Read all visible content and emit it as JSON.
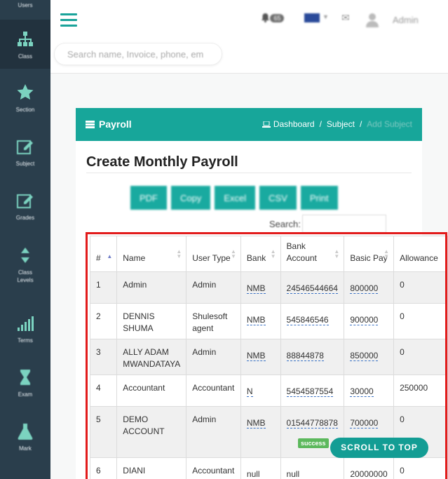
{
  "sidebar": {
    "items": [
      {
        "label": "Users",
        "icon": "users-icon"
      },
      {
        "label": "Class",
        "icon": "sitemap-icon"
      },
      {
        "label": "Section",
        "icon": "star-icon"
      },
      {
        "label": "Subject",
        "icon": "edit-icon"
      },
      {
        "label": "Grades",
        "icon": "edit-icon"
      },
      {
        "label": "Class Levels",
        "icon": "sort-icon"
      },
      {
        "label": "Terms",
        "icon": "signal-icon"
      },
      {
        "label": "Exam",
        "icon": "hourglass-icon"
      },
      {
        "label": "Mark",
        "icon": "flask-icon"
      }
    ]
  },
  "header": {
    "notification_count": "65",
    "user_name": "Admin",
    "search_placeholder": "Search name, Invoice, phone, em"
  },
  "panel": {
    "title": "Payroll",
    "breadcrumb": {
      "dashboard": "Dashboard",
      "subject": "Subject",
      "current": "Add Subject"
    },
    "page_title": "Create Monthly Payroll",
    "export_buttons": [
      "PDF",
      "Copy",
      "Excel",
      "CSV",
      "Print"
    ],
    "search_label": "Search:"
  },
  "table": {
    "columns": [
      "#",
      "Name",
      "User Type",
      "Bank",
      "Bank Account",
      "Basic Pay",
      "Allowance"
    ],
    "rows": [
      {
        "num": "1",
        "name": "Admin",
        "user_type": "Admin",
        "bank": "NMB",
        "account": "24546544664",
        "basic_pay": "800000",
        "allowance": "0"
      },
      {
        "num": "2",
        "name": "DENNIS SHUMA",
        "user_type": "Shulesoft agent",
        "bank": "NMB",
        "account": "545846546",
        "basic_pay": "900000",
        "allowance": "0"
      },
      {
        "num": "3",
        "name": "ALLY ADAM MWANDATAYA",
        "user_type": "Admin",
        "bank": "NMB",
        "account": "88844878",
        "basic_pay": "850000",
        "allowance": "0"
      },
      {
        "num": "4",
        "name": "Accountant",
        "user_type": "Accountant",
        "bank": "N",
        "account": "5454587554",
        "basic_pay": "30000",
        "allowance": "250000"
      },
      {
        "num": "5",
        "name": "DEMO ACCOUNT",
        "user_type": "Admin",
        "bank": "NMB",
        "account": "01544778878",
        "basic_pay": "700000",
        "allowance": "0"
      },
      {
        "num": "6",
        "name": "DIANI",
        "user_type": "Accountant",
        "bank": "null",
        "account": "null",
        "basic_pay": "20000000",
        "allowance": "0"
      }
    ]
  },
  "status_badge": "success",
  "scroll_top_label": "SCROLL TO TOP",
  "colors": {
    "sidebar": "#2a3e4c",
    "accent": "#17a69a",
    "highlight": "#e21b1b"
  }
}
